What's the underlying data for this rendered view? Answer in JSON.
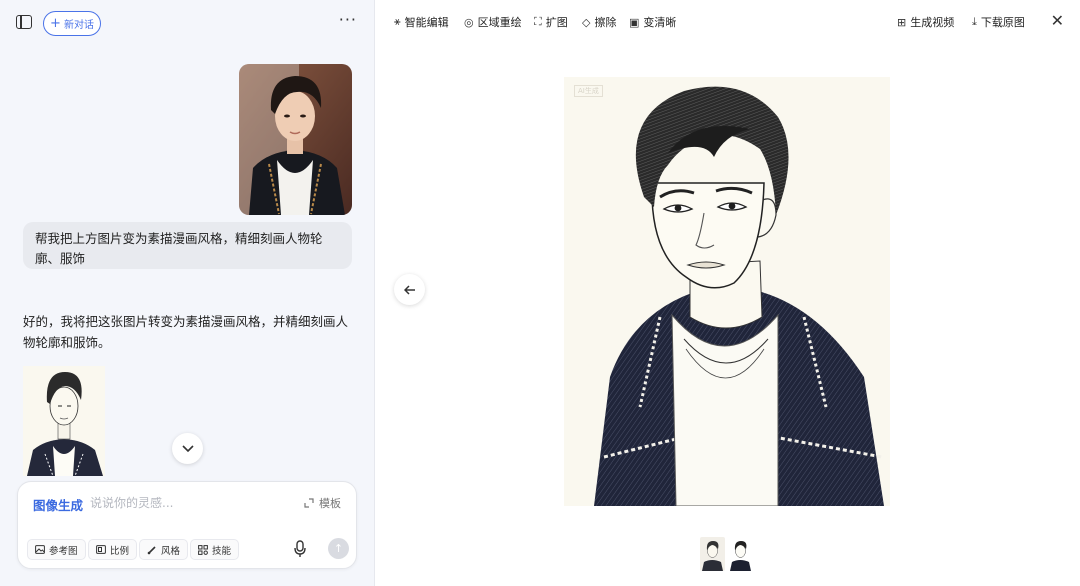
{
  "left": {
    "new_chat_label": "新对话",
    "user_message": "帮我把上方图片变为素描漫画风格，精细刻画人物轮廓、服饰",
    "ai_message": "好的，我将把这张图片转变为素描漫画风格，并精细刻画人物轮廓和服饰。",
    "composer": {
      "mode_label": "图像生成",
      "placeholder": "说说你的灵感...",
      "template_label": "模板",
      "chips": {
        "reference": "参考图",
        "ratio": "比例",
        "style": "风格",
        "skill": "技能"
      }
    }
  },
  "toolbar": {
    "smart_edit": "智能编辑",
    "region_repaint": "区域重绘",
    "expand": "扩图",
    "erase": "擦除",
    "sharpen": "变清晰",
    "generate_video": "生成视频",
    "download": "下载原图"
  },
  "viewer": {
    "watermark": "AI生成"
  },
  "icons": {
    "sidebar": "sidebar-toggle-icon",
    "more": "more-icon",
    "close": "close-icon",
    "prev": "arrow-left-icon",
    "scroll": "chevron-down-icon",
    "mic": "microphone-icon",
    "send": "send-icon"
  },
  "colors": {
    "accent": "#3b6ae0",
    "panel_bg": "#f4f6fb",
    "sketch_bg": "#faf8ef"
  }
}
